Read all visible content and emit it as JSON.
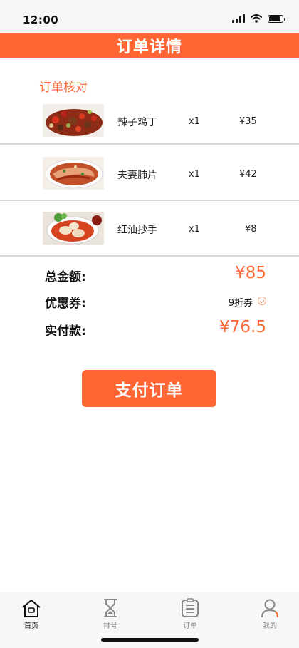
{
  "status_bar": {
    "time": "12:00"
  },
  "header": {
    "title": "订单详情"
  },
  "section": {
    "title": "订单核对"
  },
  "items": [
    {
      "name": "辣子鸡丁",
      "qty": "x1",
      "price": "¥35",
      "thumb_icon": "spicy-chicken-photo"
    },
    {
      "name": "夫妻肺片",
      "qty": "x1",
      "price": "¥42",
      "thumb_icon": "beef-slices-photo"
    },
    {
      "name": "红油抄手",
      "qty": "x1",
      "price": "¥8",
      "thumb_icon": "wonton-photo"
    }
  ],
  "summary": {
    "total_label": "总金额:",
    "total_value": "¥85",
    "coupon_label": "优惠券:",
    "coupon_value": "9折券",
    "paid_label": "实付款:",
    "paid_value": "¥76.5"
  },
  "pay_button": {
    "label": "支付订单"
  },
  "tabbar": {
    "tabs": [
      {
        "label": "首页",
        "icon": "home-icon",
        "active": true
      },
      {
        "label": "排号",
        "icon": "hourglass-icon",
        "active": false
      },
      {
        "label": "订单",
        "icon": "order-list-icon",
        "active": false
      },
      {
        "label": "我的",
        "icon": "user-icon",
        "active": false
      }
    ]
  },
  "colors": {
    "accent": "#ff6633",
    "divider": "#d9d9d9",
    "tabbar_bg": "#f7f7f7"
  }
}
